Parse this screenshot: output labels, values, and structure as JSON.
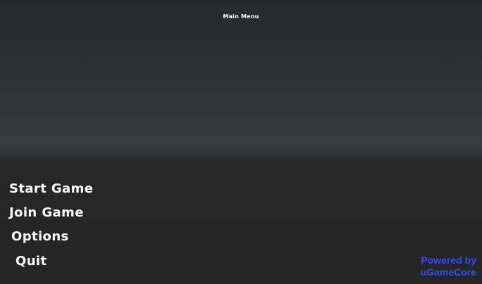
{
  "header": {
    "title": "Main Menu"
  },
  "menu": {
    "items": [
      {
        "label": "Start Game"
      },
      {
        "label": "Join Game"
      },
      {
        "label": "Options"
      },
      {
        "label": "Quit"
      }
    ]
  },
  "footer": {
    "credit_line1": "Powered by",
    "credit_line2": "uGameCore",
    "credit_color": "#2a4dff"
  },
  "colors": {
    "text": "#ffffff",
    "background": "#272727"
  }
}
